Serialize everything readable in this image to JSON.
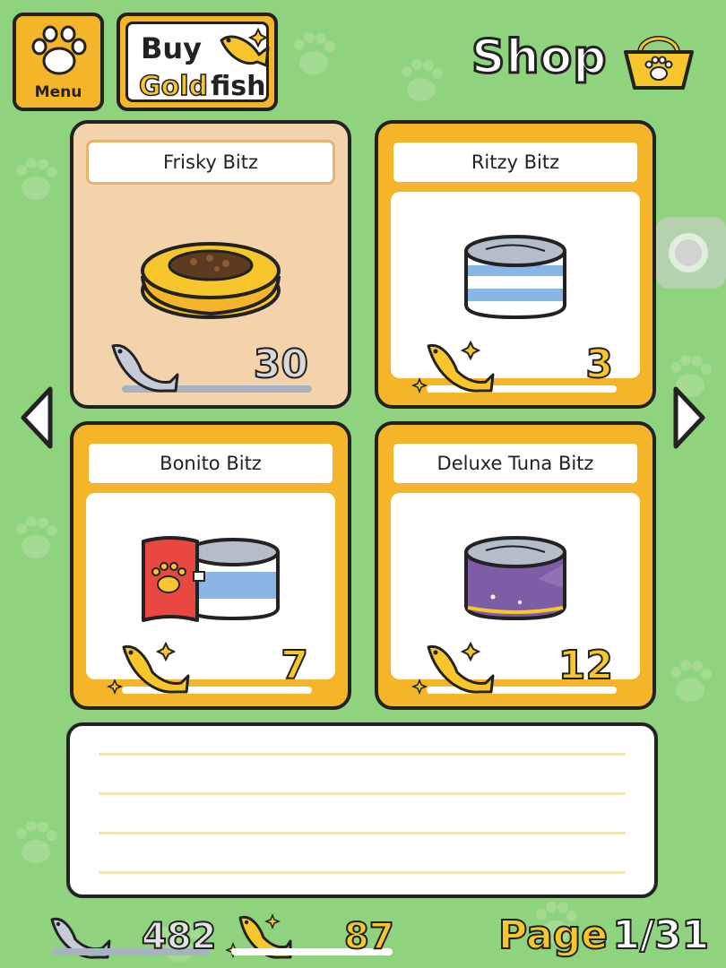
{
  "header": {
    "menu_label": "Menu",
    "buy_line1": "Buy",
    "buy_gold": "Gold",
    "buy_fish": "fish",
    "title": "Shop"
  },
  "items": [
    {
      "name": "Frisky Bitz",
      "price": "30",
      "currency": "silver",
      "selected": true
    },
    {
      "name": "Ritzy Bitz",
      "price": "3",
      "currency": "gold",
      "selected": false
    },
    {
      "name": "Bonito Bitz",
      "price": "7",
      "currency": "gold",
      "selected": false
    },
    {
      "name": "Deluxe Tuna Bitz",
      "price": "12",
      "currency": "gold",
      "selected": false
    }
  ],
  "wallet": {
    "silver": "482",
    "gold": "87"
  },
  "pagination": {
    "label": "Page",
    "value": "1/31"
  },
  "colors": {
    "background": "#8fd37f",
    "gold": "#f4b52a",
    "selected_card": "#f3d3ac"
  },
  "icons": [
    "paw-icon",
    "gold-fish-icon",
    "silver-fish-icon",
    "shopping-basket-icon",
    "left-arrow-icon",
    "right-arrow-icon"
  ]
}
